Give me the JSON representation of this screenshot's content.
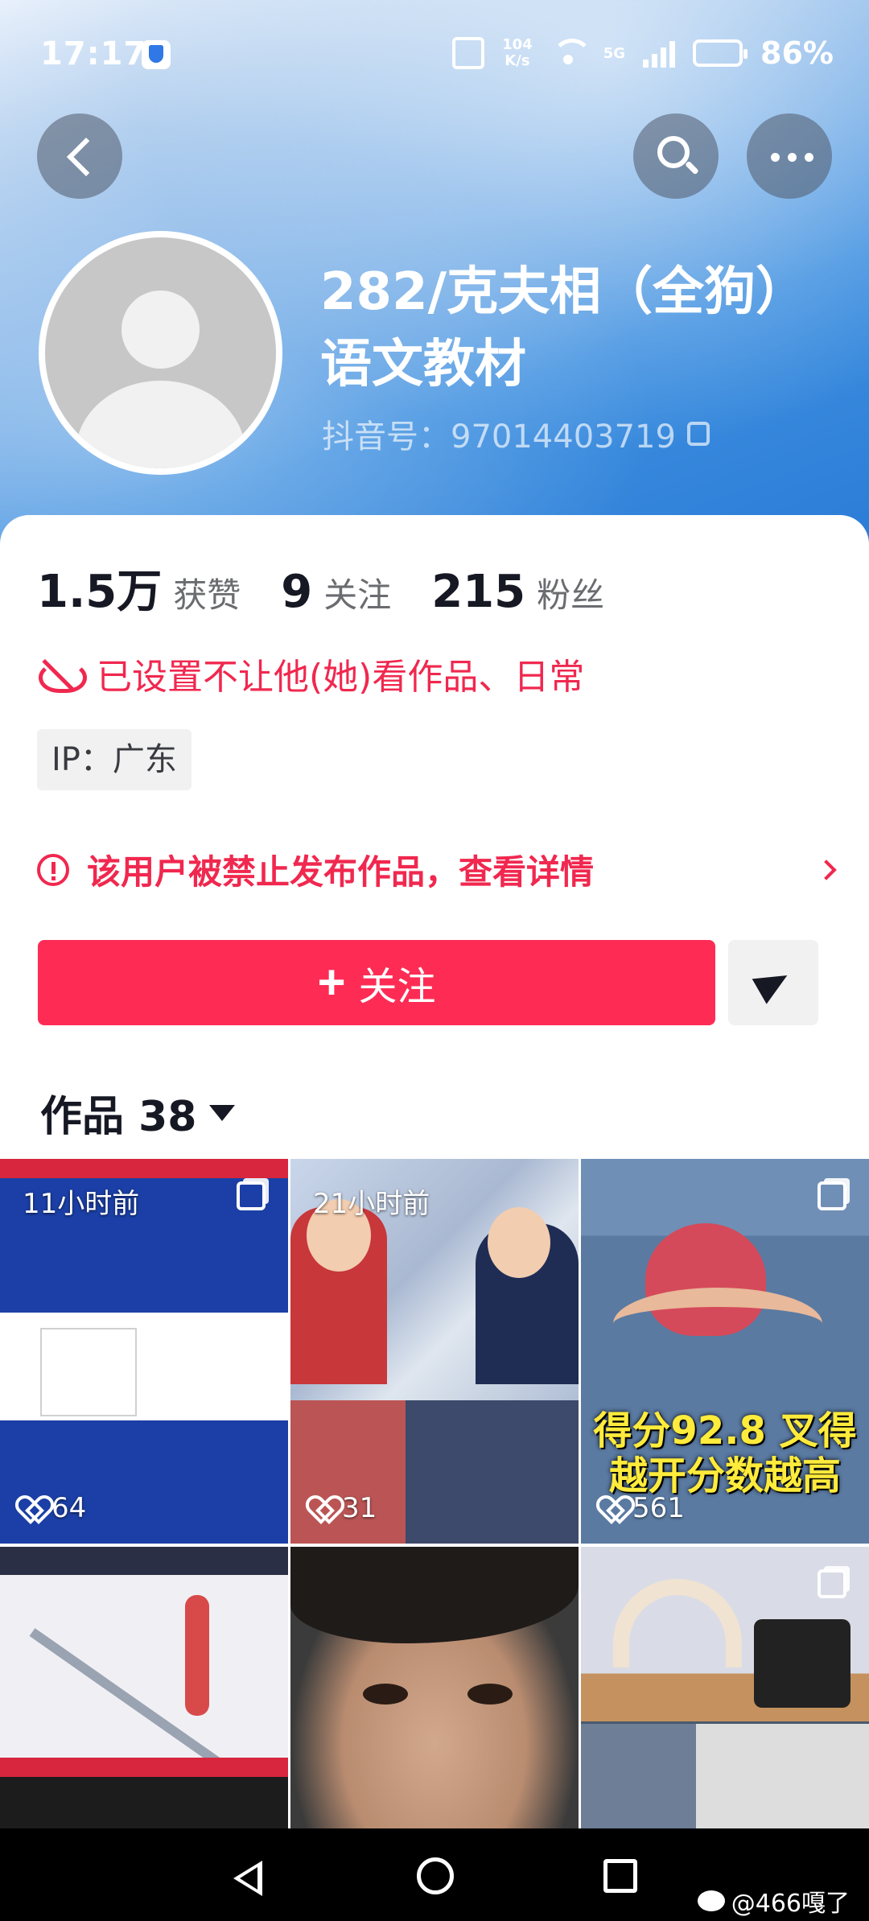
{
  "status_bar": {
    "time": "17:17",
    "speed_top": "104",
    "speed_bottom": "K/s",
    "network": "5G",
    "battery": "86%"
  },
  "profile": {
    "name": "282/克夫相（全狗）语文教材",
    "douyin_id": "抖音号：97014403719"
  },
  "stats": [
    {
      "value": "1.5万",
      "label": "获赞"
    },
    {
      "value": "9",
      "label": "关注"
    },
    {
      "value": "215",
      "label": "粉丝"
    }
  ],
  "restriction_text": "已设置不让他(她)看作品、日常",
  "ip_location": "IP：广东",
  "banned_notice": "该用户被禁止发布作品，查看详情",
  "actions": {
    "follow_label": "关注"
  },
  "works": {
    "title": "作品 38",
    "tiles": [
      {
        "time": "11小时前",
        "likes": "64"
      },
      {
        "time": "21小时前",
        "likes": "31"
      },
      {
        "time": "",
        "likes": "561",
        "overlay": "得分92.8 叉得越开分数越高"
      },
      {
        "time": "",
        "likes": ""
      },
      {
        "time": "",
        "likes": ""
      },
      {
        "time": "",
        "likes": ""
      }
    ]
  },
  "watermark": "@466嘎了",
  "colors": {
    "accent": "#fe2c55",
    "warning": "#f0284f"
  }
}
